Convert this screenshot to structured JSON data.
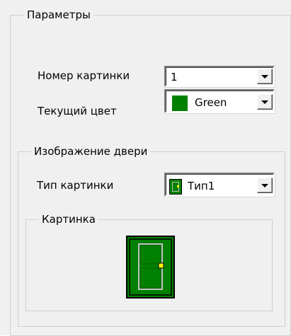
{
  "params_group": {
    "title": "Параметры"
  },
  "picture_number": {
    "label": "Номер картинки",
    "value": "1"
  },
  "current_color": {
    "label": "Текущий цвет",
    "value": "Green",
    "swatch_color": "#008000"
  },
  "door_group": {
    "title": "Изображение двери"
  },
  "picture_type": {
    "label": "Тип картинки",
    "value": "Тип1",
    "icon": "door-icon"
  },
  "picture_group": {
    "title": "Картинка"
  },
  "colors": {
    "door_green": "#008000",
    "door_frame": "#000000",
    "handle": "#ffff00"
  }
}
